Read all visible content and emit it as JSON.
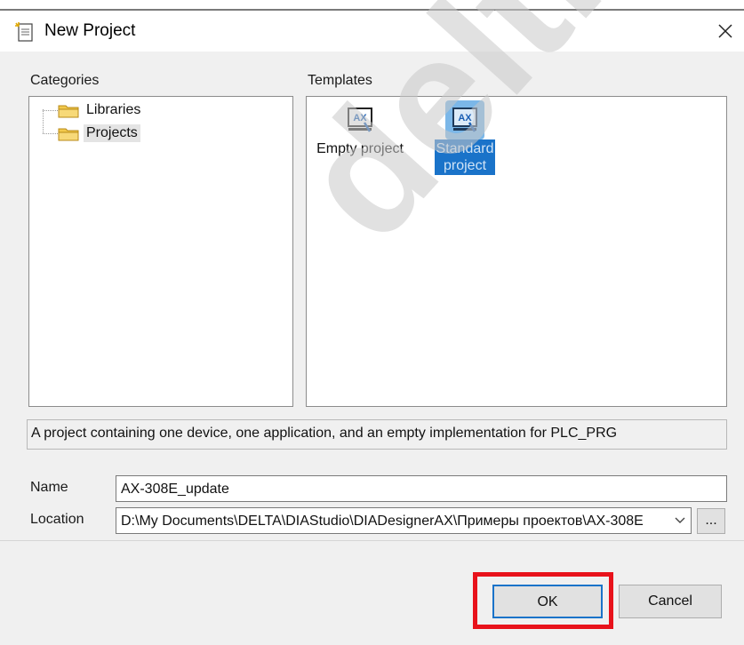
{
  "window": {
    "title": "New Project"
  },
  "categories": {
    "label": "Categories",
    "items": [
      {
        "label": "Libraries"
      },
      {
        "label": "Projects"
      }
    ]
  },
  "templates": {
    "label": "Templates",
    "items": [
      {
        "label": "Empty project",
        "icon": "ax-icon",
        "badge": "AX"
      },
      {
        "label_line1": "Standard",
        "label_line2": "project",
        "icon": "ax-icon",
        "badge": "AX"
      }
    ]
  },
  "description": "A project containing one device, one application, and an empty implementation for PLC_PRG",
  "form": {
    "name_label": "Name",
    "name_value": "AX-308E_update",
    "location_label": "Location",
    "location_value": "D:\\My Documents\\DELTA\\DIAStudio\\DIADesignerAX\\Примеры проектов\\AX-308E",
    "browse_label": "..."
  },
  "buttons": {
    "ok": "OK",
    "cancel": "Cancel"
  },
  "watermark": "deltronic",
  "colors": {
    "selection": "#1a73c9",
    "highlight": "#e8121b"
  }
}
